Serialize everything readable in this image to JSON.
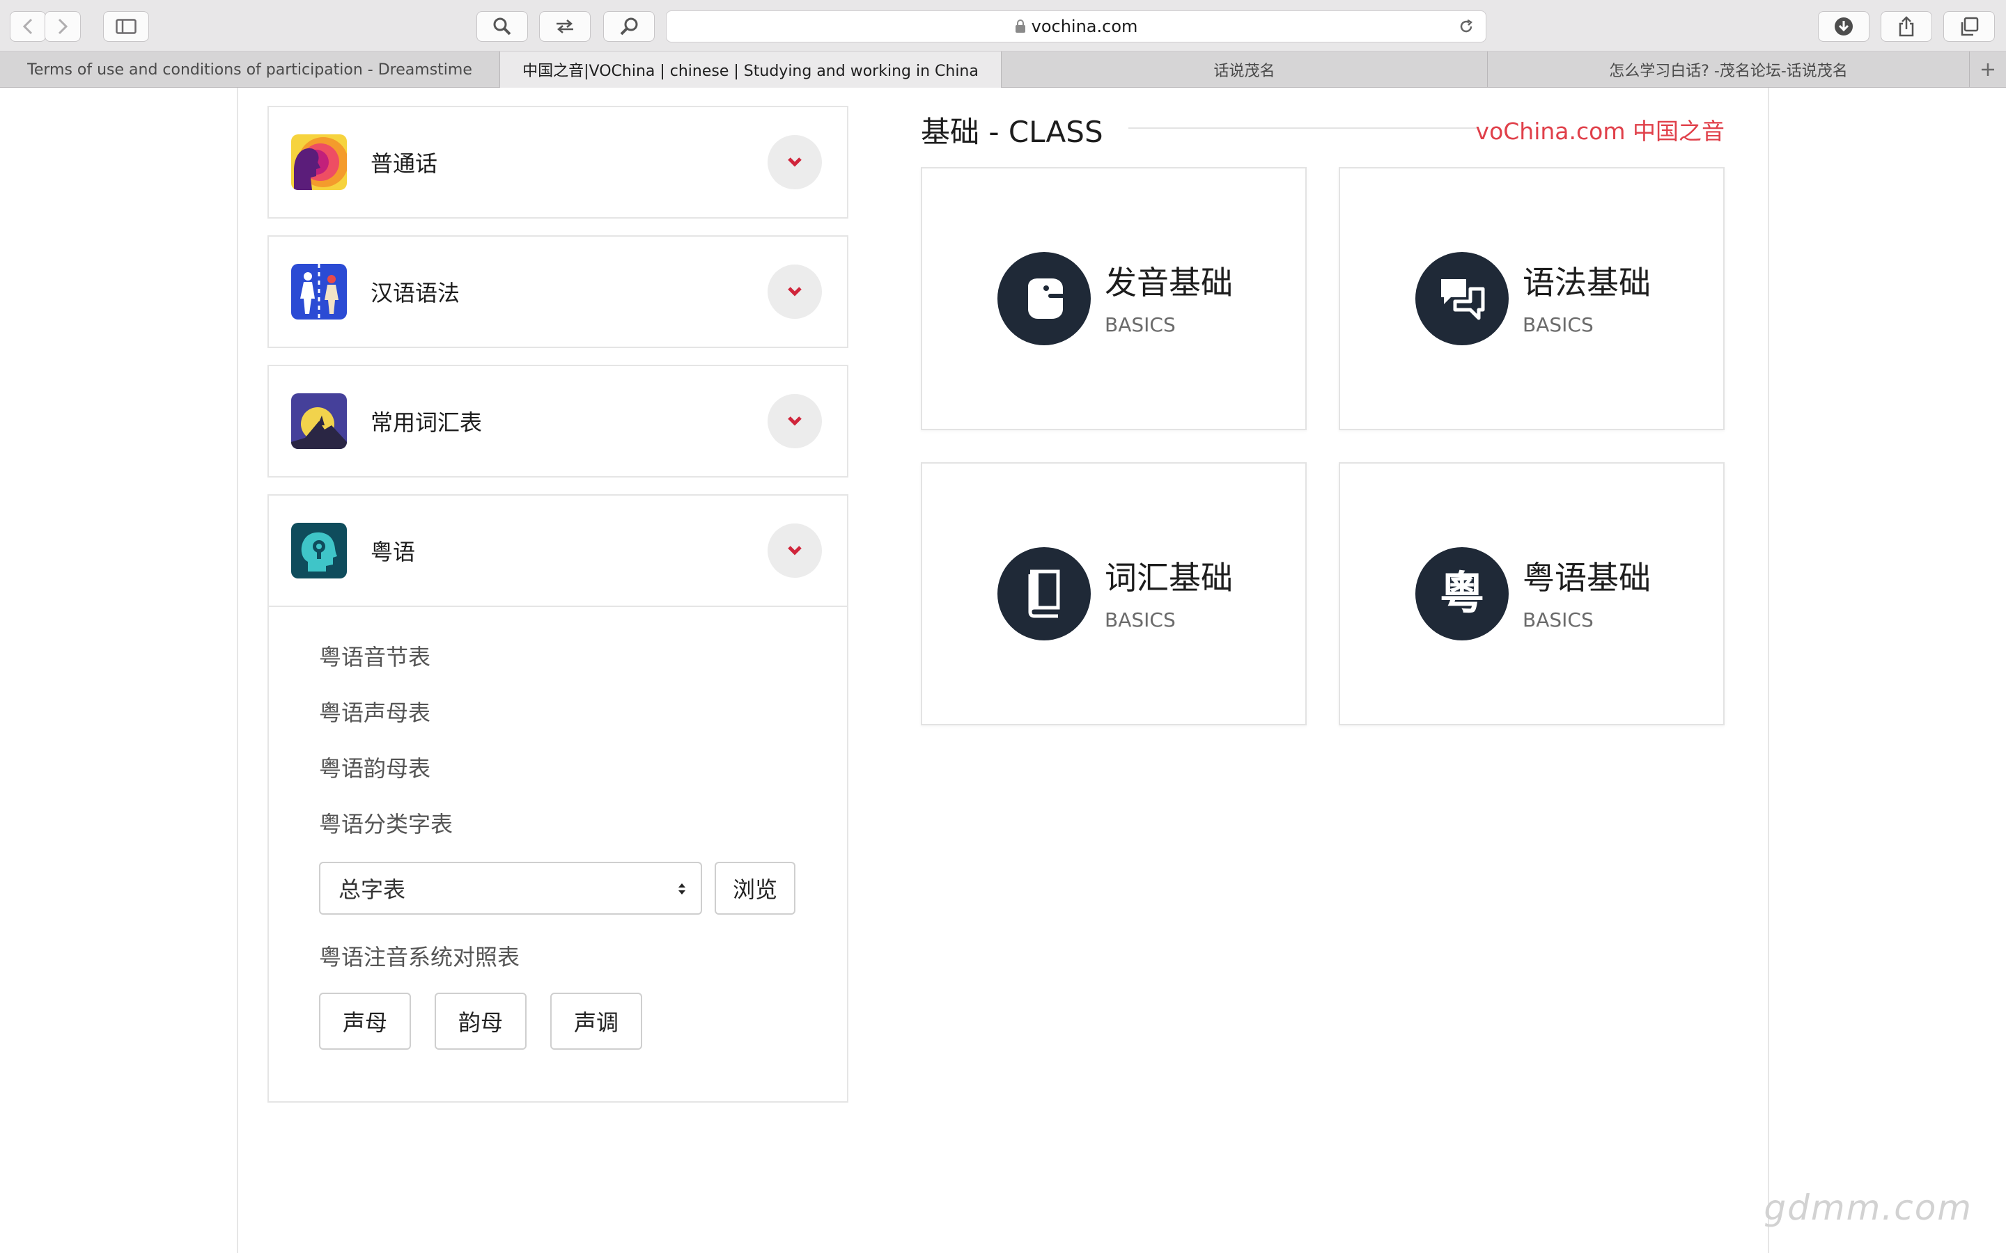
{
  "browser": {
    "url": "vochina.com",
    "tabs": [
      {
        "label": "Terms of use and conditions of participation - Dreamstime",
        "active": false
      },
      {
        "label": "中国之音|VOChina | chinese | Studying and working in China",
        "active": true
      },
      {
        "label": "话说茂名",
        "active": false
      },
      {
        "label": "怎么学习白话? -茂名论坛-话说茂名",
        "active": false
      }
    ]
  },
  "sidebar": {
    "items": [
      {
        "label": "普通话",
        "icon": "mandarin-icon"
      },
      {
        "label": "汉语语法",
        "icon": "grammar-icon"
      },
      {
        "label": "常用词汇表",
        "icon": "vocabulary-icon"
      },
      {
        "label": "粤语",
        "icon": "cantonese-icon"
      }
    ],
    "cantonese_links": [
      "粤语音节表",
      "粤语声母表",
      "粤语韵母表",
      "粤语分类字表"
    ],
    "select_value": "总字表",
    "browse_label": "浏览",
    "system_link": "粤语注音系统对照表",
    "buttons": [
      "声母",
      "韵母",
      "声调"
    ]
  },
  "section": {
    "title": "基础 - CLASS",
    "brand": "voChina.com 中国之音"
  },
  "cards": [
    {
      "title": "发音基础",
      "sub": "BASICS",
      "icon": "pronunciation-icon"
    },
    {
      "title": "语法基础",
      "sub": "BASICS",
      "icon": "chat-bubbles-icon"
    },
    {
      "title": "词汇基础",
      "sub": "BASICS",
      "icon": "book-icon"
    },
    {
      "title": "粤语基础",
      "sub": "BASICS",
      "icon": "cantonese-character-icon",
      "glyph": "粵"
    }
  ],
  "watermark": "gdmm.com",
  "colors": {
    "accent": "#e0404a",
    "icon_bg": "#1f2937",
    "chevron": "#d0253b"
  }
}
